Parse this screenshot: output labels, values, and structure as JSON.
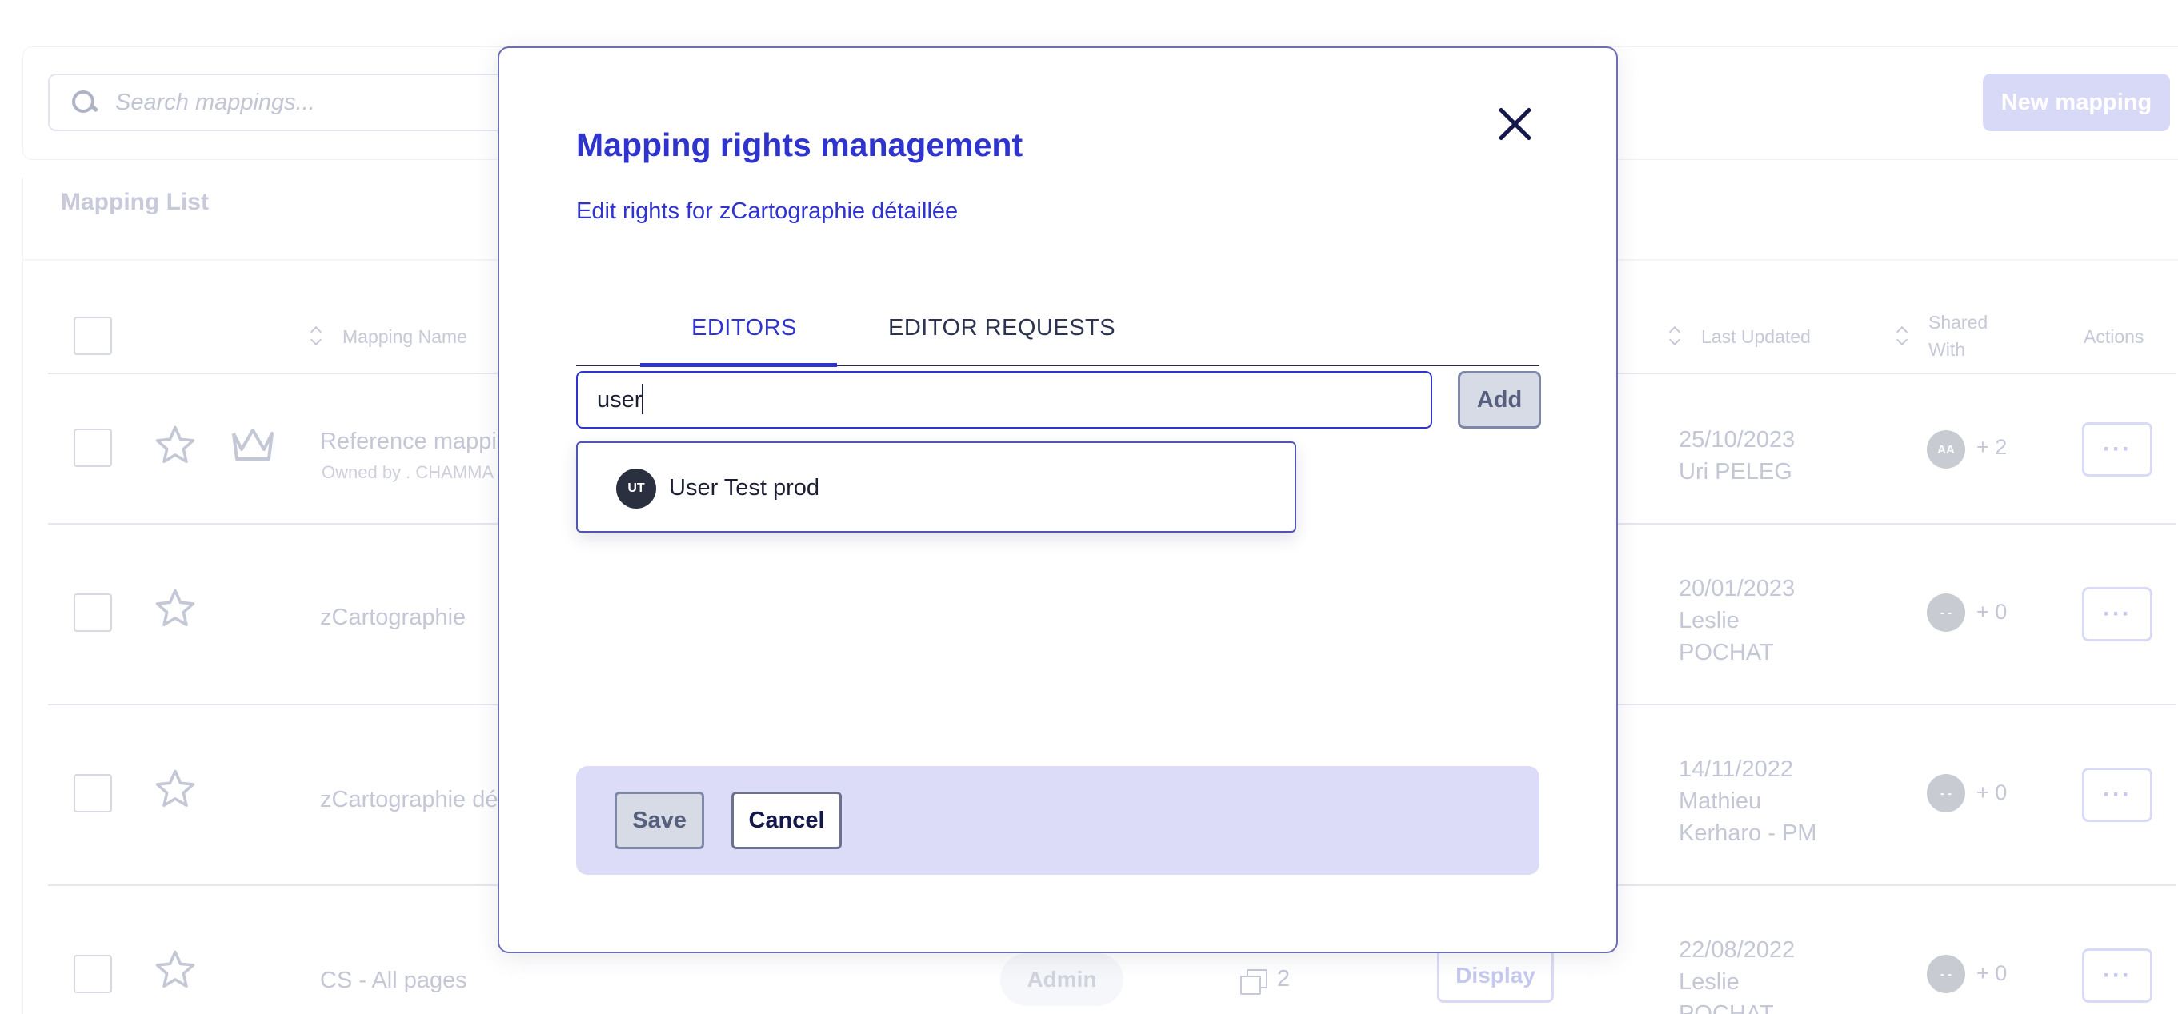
{
  "search": {
    "placeholder": "Search mappings..."
  },
  "header": {
    "new_mapping_label": "New mapping"
  },
  "list": {
    "title": "Mapping List",
    "columns": {
      "mapping_name": "Mapping Name",
      "last_updated": "Last Updated",
      "shared_with_1": "Shared",
      "shared_with_2": "With",
      "actions": "Actions"
    },
    "rows": [
      {
        "name": "Reference mappi",
        "owner": "Owned by . CHAMMA",
        "date": "25/10/2023",
        "updated_by_1": "Uri PELEG",
        "updated_by_2": "",
        "updated_by_3": "",
        "avatar": "AA",
        "shared_count": "+ 2",
        "actions": "···"
      },
      {
        "name": "zCartographie",
        "owner": "",
        "date": "20/01/2023",
        "updated_by_1": "Leslie",
        "updated_by_2": "POCHAT",
        "updated_by_3": "",
        "avatar": "- -",
        "shared_count": "+ 0",
        "actions": "···"
      },
      {
        "name": "zCartographie dé",
        "owner": "",
        "date": "14/11/2022",
        "updated_by_1": "Mathieu",
        "updated_by_2": "Kerharo - PM",
        "updated_by_3": "",
        "avatar": "- -",
        "shared_count": "+ 0",
        "actions": "···"
      },
      {
        "name": "CS - All pages",
        "owner": "",
        "date": "22/08/2022",
        "updated_by_1": "Leslie",
        "updated_by_2": "POCHAT",
        "updated_by_3": "",
        "avatar": "- -",
        "shared_count": "+ 0",
        "actions": "···",
        "role": "Admin",
        "pages": "2",
        "display_label": "Display"
      }
    ]
  },
  "modal": {
    "title": "Mapping rights management",
    "subtitle": "Edit rights for zCartographie détaillée",
    "tabs": {
      "editors": "EDITORS",
      "editor_requests": "EDITOR REQUESTS"
    },
    "input_value": "user",
    "add_label": "Add",
    "suggestion": {
      "initials": "UT",
      "name": "User Test prod"
    },
    "save_label": "Save",
    "cancel_label": "Cancel"
  },
  "colors": {
    "accent": "#3034cf",
    "dark_navy": "#14184a",
    "footer_bar": "#dcdcf8",
    "muted_text": "#c4c7d6"
  },
  "icons": [
    "search-icon",
    "star-icon",
    "crown-icon",
    "sort-icon",
    "close-icon",
    "pages-icon"
  ]
}
